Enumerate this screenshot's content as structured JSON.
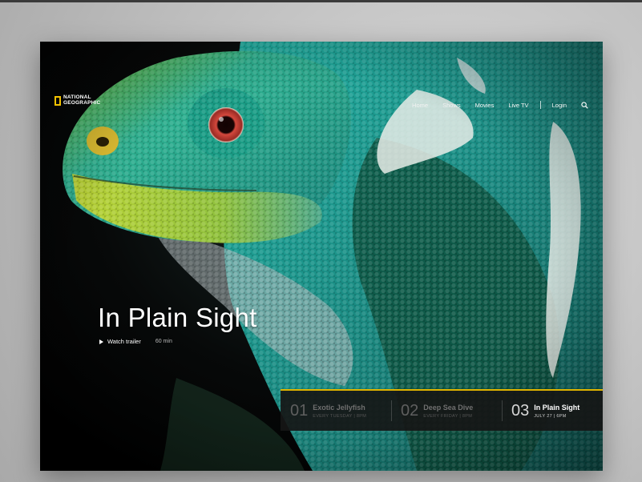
{
  "brand": {
    "name": "NATIONAL\nGEOGRAPHIC",
    "accent_color": "#f2c200"
  },
  "nav": {
    "items": [
      "Home",
      "Shows",
      "Movies",
      "Live TV"
    ],
    "login_label": "Login",
    "search_icon": "search-icon"
  },
  "hero": {
    "title": "In Plain Sight",
    "trailer_label": "Watch trailer",
    "duration": "60 min",
    "play_icon": "play-icon"
  },
  "episodes": [
    {
      "number": "01",
      "title": "Exotic Jellyfish",
      "schedule": "EVERY TUESDAY | 8PM",
      "active": false
    },
    {
      "number": "02",
      "title": "Deep Sea Dive",
      "schedule": "EVERY FRIDAY | 8PM",
      "active": false
    },
    {
      "number": "03",
      "title": "In Plain Sight",
      "schedule": "JULY 27 | 6PM",
      "active": true
    }
  ],
  "colors": {
    "episode_bar_border": "#e0b400",
    "iguana_teal": "#1fa69a",
    "iguana_green": "#9ccc2a",
    "eye_red": "#c8443a"
  }
}
